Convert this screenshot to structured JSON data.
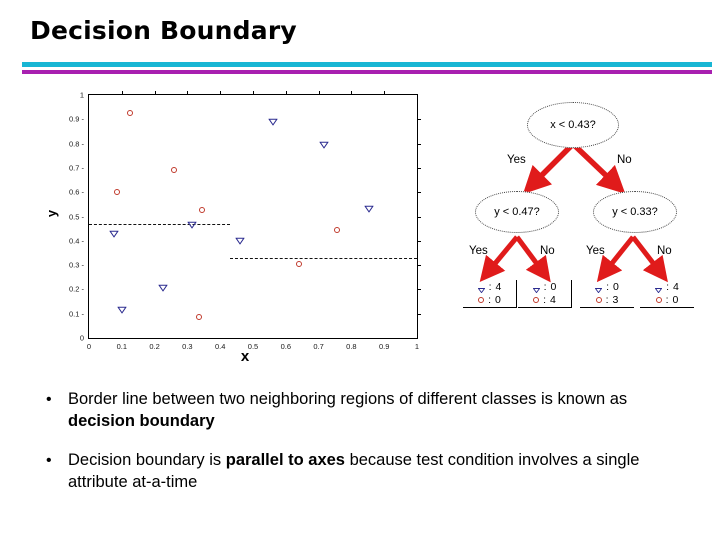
{
  "slide": {
    "title": "Decision Boundary",
    "divider": {
      "top_color": "#18b6d4",
      "bottom_color": "#a820b0"
    }
  },
  "chart_data": {
    "type": "scatter",
    "title": "",
    "xlabel": "x",
    "ylabel": "y",
    "xlim": [
      0,
      1
    ],
    "ylim": [
      0,
      1
    ],
    "grid": false,
    "x_ticks": [
      "0",
      "0.1",
      "0.2",
      "0.3",
      "0.4",
      "0.5",
      "0.6",
      "0.7",
      "0.8",
      "0.9",
      "1"
    ],
    "y_ticks": [
      "0",
      "0.1",
      "0.2",
      "0.3",
      "0.4",
      "0.5",
      "0.6",
      "0.7",
      "0.8",
      "0.9",
      "1"
    ],
    "legend_position": "none",
    "series": [
      {
        "name": "circle-class",
        "marker": "circle",
        "color": "#c0392b",
        "points": [
          {
            "x": 0.125,
            "y": 0.925
          },
          {
            "x": 0.26,
            "y": 0.69
          },
          {
            "x": 0.085,
            "y": 0.6
          },
          {
            "x": 0.345,
            "y": 0.525
          },
          {
            "x": 0.335,
            "y": 0.085
          },
          {
            "x": 0.64,
            "y": 0.305
          },
          {
            "x": 0.755,
            "y": 0.445
          }
        ]
      },
      {
        "name": "triangle-class",
        "marker": "triangle-down",
        "color": "#2b2b8f",
        "points": [
          {
            "x": 0.56,
            "y": 0.885
          },
          {
            "x": 0.715,
            "y": 0.79
          },
          {
            "x": 0.855,
            "y": 0.525
          },
          {
            "x": 0.075,
            "y": 0.425
          },
          {
            "x": 0.315,
            "y": 0.46
          },
          {
            "x": 0.46,
            "y": 0.395
          },
          {
            "x": 0.225,
            "y": 0.2
          },
          {
            "x": 0.1,
            "y": 0.11
          }
        ]
      }
    ],
    "decision_boundaries": [
      {
        "orientation": "horizontal",
        "y": 0.47,
        "x_from": 0.0,
        "x_to": 0.43,
        "style": "dashed"
      },
      {
        "orientation": "horizontal",
        "y": 0.33,
        "x_from": 0.43,
        "x_to": 1.0,
        "style": "dashed"
      }
    ]
  },
  "tree": {
    "root": {
      "label": "x < 0.43?"
    },
    "branches": {
      "yes": "Yes",
      "no": "No"
    },
    "children": [
      {
        "label": "y < 0.47?"
      },
      {
        "label": "y < 0.33?"
      }
    ],
    "leaves": [
      {
        "tri_count": "4",
        "circ_count": "0",
        "colon": ":"
      },
      {
        "tri_count": "0",
        "circ_count": "4",
        "colon": ":"
      },
      {
        "tri_count": "0",
        "circ_count": "3",
        "colon": ":"
      },
      {
        "tri_count": "4",
        "circ_count": "0",
        "colon": ":"
      }
    ],
    "arrow_color": "#e01b1b"
  },
  "bullets": [
    {
      "marker": "•",
      "pre": " Border line between two neighboring regions of different classes is known as ",
      "bold": "decision boundary",
      "post": ""
    },
    {
      "marker": "•",
      "pre": " Decision boundary is ",
      "bold": "parallel to axes",
      "post": " because test condition involves a single attribute at-a-time"
    }
  ]
}
